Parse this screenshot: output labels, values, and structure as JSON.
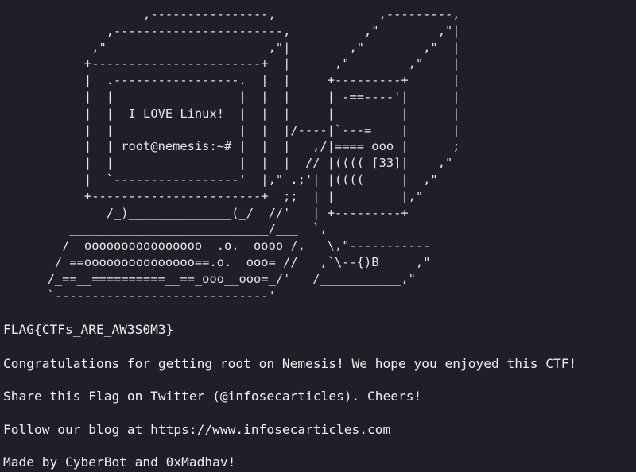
{
  "terminal": {
    "ascii_art": "                   ,----------------,              ,---------,\n              ,-----------------------,          ,\"        ,\"|\n            ,\"                      ,\"|        ,\"        ,\"  |\n           +-----------------------+  |      ,\"        ,\"    |\n           |  .-----------------.  |  |     +---------+      |\n           |  |                 |  |  |     | -==----'|      |\n           |  |  I LOVE Linux!  |  |  |     |         |      |\n           |  |                 |  |  |/----|`---=    |      |\n           |  | root@nemesis:~# |  |  |   ,/|==== ooo |      ;\n           |  |                 |  |  |  // |(((( [33]|    ,\"\n           |  `-----------------'  |,\" .;'| |((((     |  ,\"\n           +-----------------------+  ;;  | |         |,\"\n              /_)______________(_/  //'   | +---------+\n         ___________________________/___  `,\n        /  oooooooooooooooo  .o.  oooo /,   \\,\"-----------\n       / ==ooooooooooooooo==.o.  ooo= //   ,`\\--{)B     ,\"\n      /_==__==========__==_ooo__ooo=_/'   /___________,\"\n      `-----------------------------'",
    "flag": "FLAG{CTFs_ARE_AW3S0M3}",
    "congrats": "Congratulations for getting root on Nemesis! We hope you enjoyed this CTF!",
    "share": "Share this Flag on Twitter (@infosecarticles). Cheers!",
    "follow": "Follow our blog at https://www.infosecarticles.com",
    "made_by": "Made by CyberBot and 0xMadhav!"
  },
  "colors": {
    "background": "#1e1f29",
    "text": "#e6e6e6"
  }
}
